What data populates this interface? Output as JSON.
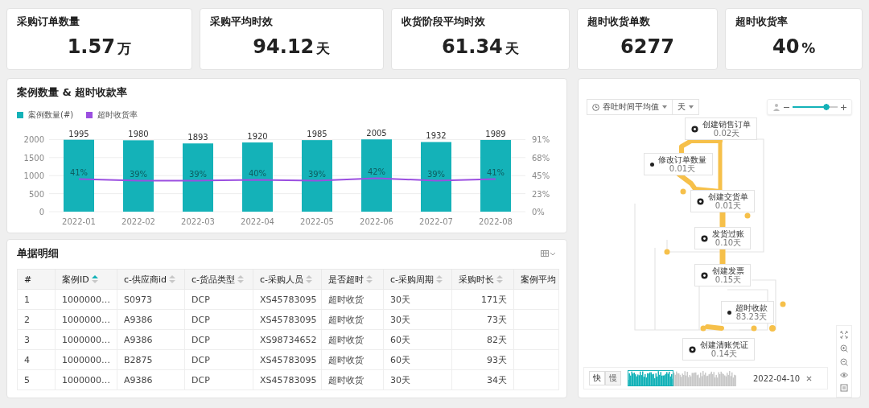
{
  "kpis": [
    {
      "label": "采购订单数量",
      "value": "1.57",
      "unit": "万"
    },
    {
      "label": "采购平均时效",
      "value": "94.12",
      "unit": "天"
    },
    {
      "label": "收货阶段平均时效",
      "value": "61.34",
      "unit": "天"
    },
    {
      "label": "超时收货单数",
      "value": "6277"
    },
    {
      "label": "超时收货率",
      "value": "40",
      "unit": "%"
    }
  ],
  "chart_panel": {
    "title": "案例数量 & 超时收款率",
    "chart_data": {
      "type": "bar",
      "categories": [
        "2022-01",
        "2022-02",
        "2022-03",
        "2022-04",
        "2022-05",
        "2022-06",
        "2022-07",
        "2022-08"
      ],
      "series": [
        {
          "name": "案例数量(#)",
          "color": "#14b2b8",
          "values": [
            1995,
            1980,
            1893,
            1920,
            1985,
            2005,
            1932,
            1989
          ]
        },
        {
          "name": "超时收货率",
          "color": "#9b4fe0",
          "values": [
            0.41,
            0.39,
            0.39,
            0.4,
            0.39,
            0.42,
            0.39,
            0.41
          ]
        }
      ],
      "ylim": [
        0,
        2010
      ],
      "yticks": [
        0,
        500,
        1000,
        1500,
        2000
      ],
      "y2lim": [
        0,
        0.91
      ],
      "y2ticks": [
        {
          "value": 0,
          "label": "0%"
        },
        {
          "value": 0.2275,
          "label": "23%"
        },
        {
          "value": 0.455,
          "label": "45%"
        },
        {
          "value": 0.6825,
          "label": "68%"
        },
        {
          "value": 0.91,
          "label": "91%"
        }
      ],
      "grid": true,
      "value_labels": [
        [
          "1995",
          "1980",
          "1893",
          "1920",
          "1985",
          "2005",
          "1932",
          "1989"
        ],
        [
          "41%",
          "39%",
          "39%",
          "40%",
          "39%",
          "42%",
          "39%",
          "41%"
        ]
      ]
    }
  },
  "table_panel": {
    "title": "单据明细",
    "columns": [
      {
        "label": "#",
        "sortable": false,
        "sorted": false
      },
      {
        "label": "案例ID",
        "sortable": true,
        "sorted": true
      },
      {
        "label": "c-供应商id",
        "sortable": true,
        "sorted": false
      },
      {
        "label": "c-货品类型",
        "sortable": true,
        "sorted": false
      },
      {
        "label": "c-采购人员",
        "sortable": true,
        "sorted": false
      },
      {
        "label": "是否超时",
        "sortable": true,
        "sorted": false
      },
      {
        "label": "c-采购周期",
        "sortable": true,
        "sorted": false
      },
      {
        "label": "采购时长",
        "sortable": true,
        "sorted": false
      },
      {
        "label": "案例平均"
      }
    ],
    "rows": [
      [
        "1",
        "1000000…",
        "S0973",
        "DCP",
        "XS45783095",
        "超时收货",
        "30天",
        "171天",
        null
      ],
      [
        "2",
        "1000000…",
        "A9386",
        "DCP",
        "XS45783095",
        "超时收货",
        "30天",
        "73天",
        null
      ],
      [
        "3",
        "1000000…",
        "A9386",
        "DCP",
        "XS98734652",
        "超时收货",
        "60天",
        "82天",
        null
      ],
      [
        "4",
        "1000000…",
        "B2875",
        "DCP",
        "XS45783095",
        "超时收货",
        "60天",
        "93天",
        null
      ],
      [
        "5",
        "1000000…",
        "A9386",
        "DCP",
        "XS45783095",
        "超时收货",
        "30天",
        "34天",
        null
      ]
    ]
  },
  "process_map": {
    "metric_select": "吞吐时间平均值",
    "unit_select": "天",
    "detail_slider": {
      "level": 0.82
    },
    "nodes": [
      {
        "name": "创建销售订单",
        "time": "0.02天",
        "kind": "main"
      },
      {
        "name": "修改订单数量",
        "time": "0.01天",
        "kind": "side"
      },
      {
        "name": "创建交货单",
        "time": "0.01天",
        "kind": "main"
      },
      {
        "name": "发货过账",
        "time": "0.10天",
        "kind": "main"
      },
      {
        "name": "创建发票",
        "time": "0.15天",
        "kind": "main"
      },
      {
        "name": "超时收款",
        "time": "83.23天",
        "kind": "side"
      },
      {
        "name": "创建清账凭证",
        "time": "0.14天",
        "kind": "main"
      }
    ],
    "speed_toggle": [
      {
        "label": "快",
        "selected": true
      },
      {
        "label": "慢",
        "selected": false
      }
    ],
    "timeline": {
      "level": 0.42,
      "date": "2022-04-10"
    }
  }
}
